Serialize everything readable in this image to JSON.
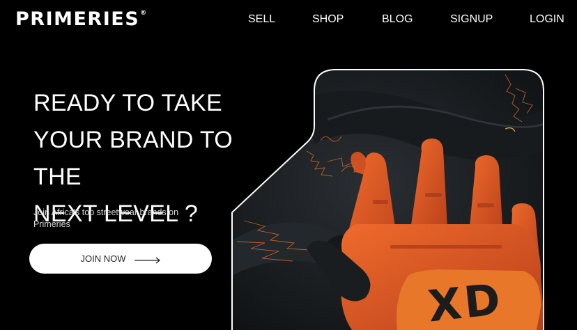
{
  "brand": {
    "name": "PRIMERIES",
    "mark": "®"
  },
  "nav": {
    "sell": "SELL",
    "shop": "SHOP",
    "blog": "BLOG",
    "signup": "SIGNUP",
    "login": "LOGIN"
  },
  "hero": {
    "headline_line1": "READY TO TAKE",
    "headline_line2": "YOUR BRAND TO THE",
    "headline_line3": "NEXT LEVEL ?",
    "subtext": "Join Africa's top streetwear brands on Primeries",
    "cta_label": "JOIN NOW",
    "glove_print": "XD"
  },
  "colors": {
    "background": "#000000",
    "text": "#ffffff",
    "button_bg": "#ffffff",
    "glove_orange": "#e0541f",
    "fabric": "#1c2024"
  },
  "icons": {
    "cta_arrow": "long-arrow-right-icon"
  }
}
